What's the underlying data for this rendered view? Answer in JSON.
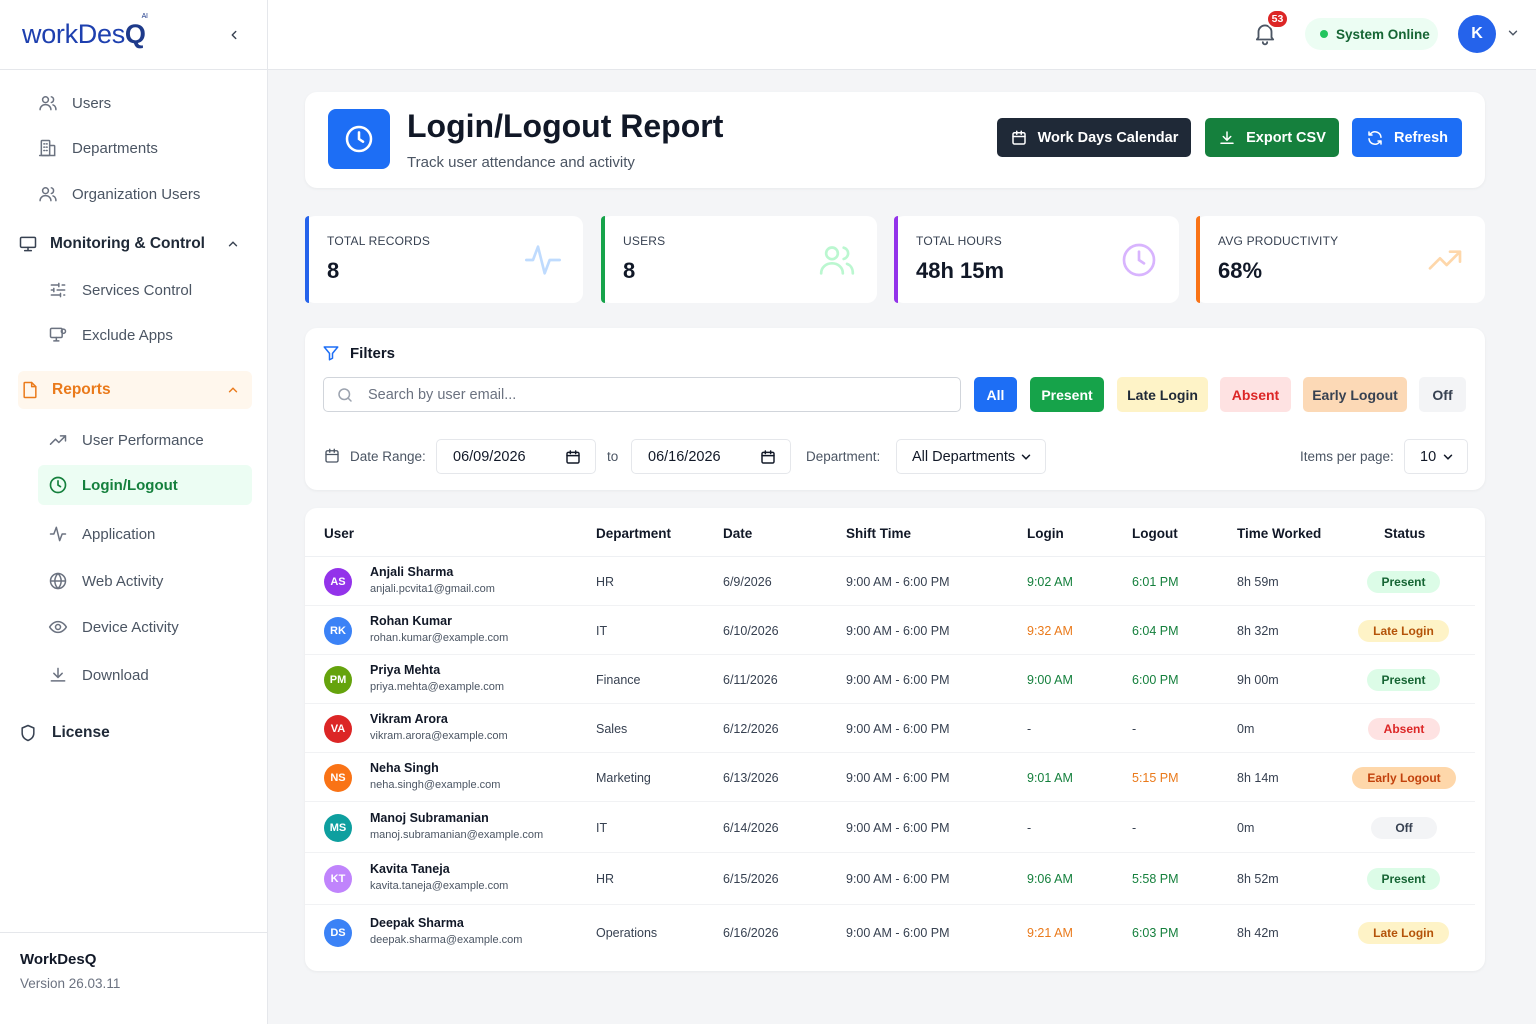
{
  "app": {
    "logo_main": "workDes",
    "logo_bold": "Q",
    "logo_ai": "AI"
  },
  "sidebar": {
    "top_items": [
      {
        "label": "Users",
        "icon": "users-icon"
      },
      {
        "label": "Departments",
        "icon": "building-icon"
      },
      {
        "label": "Organization Users",
        "icon": "users-icon"
      }
    ],
    "monitoring": {
      "label": "Monitoring & Control",
      "items": [
        {
          "label": "Services Control",
          "icon": "sliders-icon"
        },
        {
          "label": "Exclude Apps",
          "icon": "monitor-icon"
        }
      ]
    },
    "reports": {
      "label": "Reports",
      "items": [
        {
          "label": "User Performance",
          "icon": "trend-icon"
        },
        {
          "label": "Login/Logout",
          "icon": "clock-icon",
          "active": true
        },
        {
          "label": "Application",
          "icon": "activity-icon"
        },
        {
          "label": "Web Activity",
          "icon": "globe-icon"
        },
        {
          "label": "Device Activity",
          "icon": "eye-icon"
        },
        {
          "label": "Download",
          "icon": "download-icon"
        }
      ]
    },
    "license": {
      "label": "License",
      "icon": "shield-icon"
    },
    "footer": {
      "name": "WorkDesQ",
      "version": "Version 26.03.11"
    }
  },
  "topbar": {
    "notifications": "53",
    "status": "System Online",
    "avatar": "K"
  },
  "header": {
    "title": "Login/Logout Report",
    "subtitle": "Track user attendance and activity",
    "buttons": {
      "calendar": "Work Days Calendar",
      "export": "Export CSV",
      "refresh": "Refresh"
    }
  },
  "stats": [
    {
      "label": "TOTAL RECORDS",
      "value": "8",
      "color": "#2563eb"
    },
    {
      "label": "USERS",
      "value": "8",
      "color": "#16a34a"
    },
    {
      "label": "TOTAL HOURS",
      "value": "48h 15m",
      "color": "#9333ea"
    },
    {
      "label": "AVG PRODUCTIVITY",
      "value": "68%",
      "color": "#f97316"
    }
  ],
  "filters": {
    "title": "Filters",
    "search_placeholder": "Search by user email...",
    "chips": {
      "all": "All",
      "present": "Present",
      "late": "Late Login",
      "absent": "Absent",
      "early": "Early Logout",
      "off": "Off"
    },
    "date_range_label": "Date Range:",
    "date_from": "06/09/2026",
    "to_label": "to",
    "date_to": "06/16/2026",
    "department_label": "Department:",
    "department_value": "All Departments",
    "items_label": "Items per page:",
    "items_value": "10"
  },
  "table": {
    "headers": {
      "user": "User",
      "department": "Department",
      "date": "Date",
      "shift": "Shift Time",
      "login": "Login",
      "logout": "Logout",
      "worked": "Time Worked",
      "status": "Status"
    },
    "rows": [
      {
        "initials": "AS",
        "avatar_color": "#9333ea",
        "name": "Anjali Sharma",
        "email": "anjali.pcvita1@gmail.com",
        "department": "HR",
        "date": "6/9/2026",
        "shift": "9:00 AM - 6:00 PM",
        "login": "9:02 AM",
        "login_color": "green",
        "logout": "6:01 PM",
        "logout_color": "green",
        "worked": "8h 59m",
        "status": "Present",
        "status_kind": "present"
      },
      {
        "initials": "RK",
        "avatar_color": "#3b82f6",
        "name": "Rohan Kumar",
        "email": "rohan.kumar@example.com",
        "department": "IT",
        "date": "6/10/2026",
        "shift": "9:00 AM - 6:00 PM",
        "login": "9:32 AM",
        "login_color": "orange",
        "logout": "6:04 PM",
        "logout_color": "green",
        "worked": "8h 32m",
        "status": "Late Login",
        "status_kind": "late"
      },
      {
        "initials": "PM",
        "avatar_color": "#65a30d",
        "name": "Priya Mehta",
        "email": "priya.mehta@example.com",
        "department": "Finance",
        "date": "6/11/2026",
        "shift": "9:00 AM - 6:00 PM",
        "login": "9:00 AM",
        "login_color": "green",
        "logout": "6:00 PM",
        "logout_color": "green",
        "worked": "9h 00m",
        "status": "Present",
        "status_kind": "present"
      },
      {
        "initials": "VA",
        "avatar_color": "#dc2626",
        "name": "Vikram Arora",
        "email": "vikram.arora@example.com",
        "department": "Sales",
        "date": "6/12/2026",
        "shift": "9:00 AM - 6:00 PM",
        "login": "-",
        "login_color": "plain",
        "logout": "-",
        "logout_color": "plain",
        "worked": "0m",
        "status": "Absent",
        "status_kind": "absent"
      },
      {
        "initials": "NS",
        "avatar_color": "#f97316",
        "name": "Neha Singh",
        "email": "neha.singh@example.com",
        "department": "Marketing",
        "date": "6/13/2026",
        "shift": "9:00 AM - 6:00 PM",
        "login": "9:01 AM",
        "login_color": "green",
        "logout": "5:15 PM",
        "logout_color": "orange",
        "worked": "8h 14m",
        "status": "Early Logout",
        "status_kind": "early"
      },
      {
        "initials": "MS",
        "avatar_color": "#0e9f9f",
        "name": "Manoj Subramanian",
        "email": "manoj.subramanian@example.com",
        "department": "IT",
        "date": "6/14/2026",
        "shift": "9:00 AM - 6:00 PM",
        "login": "-",
        "login_color": "plain",
        "logout": "-",
        "logout_color": "plain",
        "worked": "0m",
        "status": "Off",
        "status_kind": "off"
      },
      {
        "initials": "KT",
        "avatar_color": "#c084fc",
        "name": "Kavita Taneja",
        "email": "kavita.taneja@example.com",
        "department": "HR",
        "date": "6/15/2026",
        "shift": "9:00 AM - 6:00 PM",
        "login": "9:06 AM",
        "login_color": "green",
        "logout": "5:58 PM",
        "logout_color": "green",
        "worked": "8h 52m",
        "status": "Present",
        "status_kind": "present"
      },
      {
        "initials": "DS",
        "avatar_color": "#3b82f6",
        "name": "Deepak Sharma",
        "email": "deepak.sharma@example.com",
        "department": "Operations",
        "date": "6/16/2026",
        "shift": "9:00 AM - 6:00 PM",
        "login": "9:21 AM",
        "login_color": "orange",
        "logout": "6:03 PM",
        "logout_color": "green",
        "worked": "8h 42m",
        "status": "Late Login",
        "status_kind": "late"
      }
    ]
  }
}
